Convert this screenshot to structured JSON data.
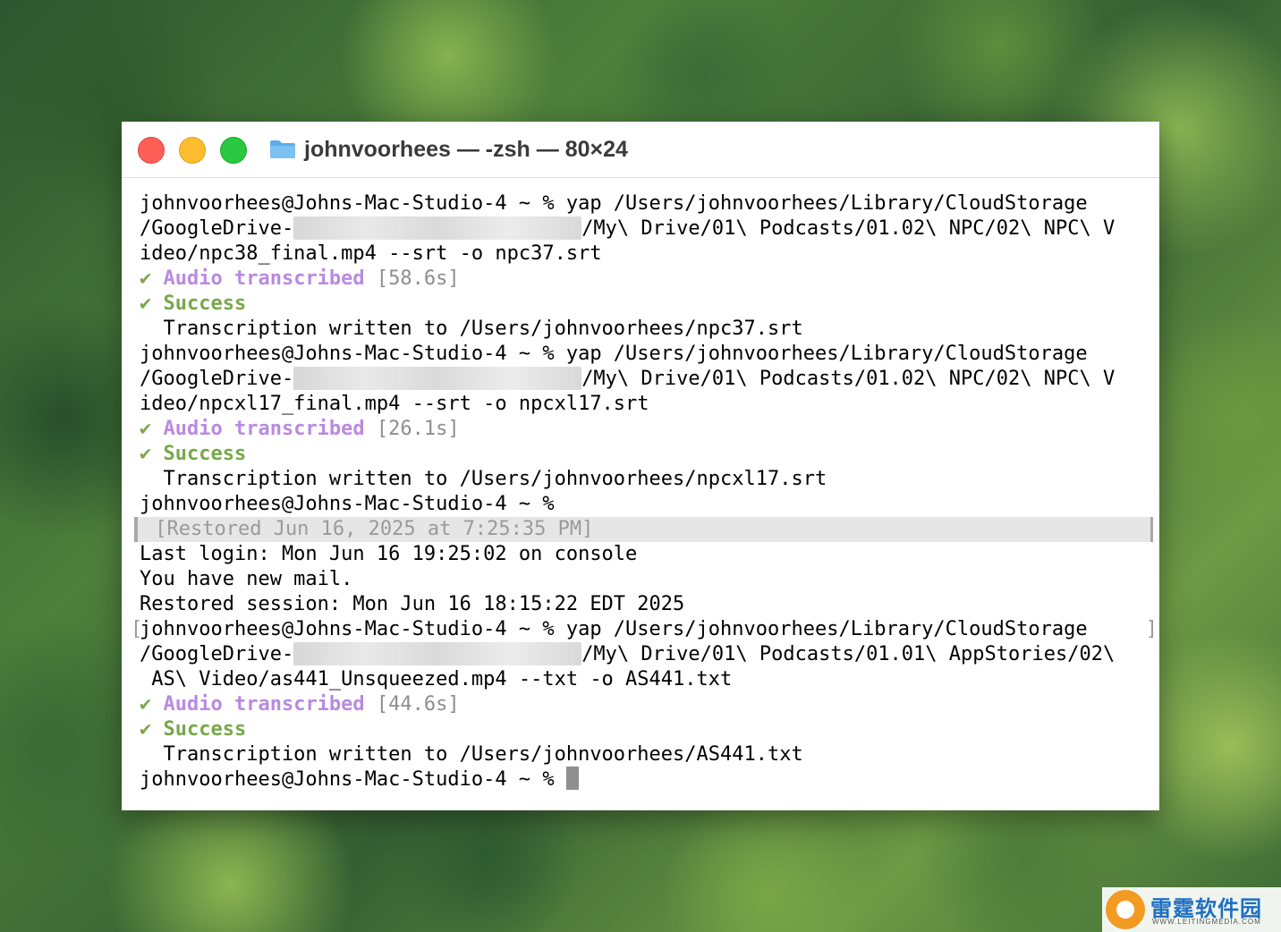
{
  "window": {
    "title": "johnvoorhees — -zsh — 80×24"
  },
  "terminal": {
    "lines": {
      "l1": "johnvoorhees@Johns-Mac-Studio-4 ~ % yap /Users/johnvoorhees/Library/CloudStorage",
      "l2a": "/GoogleDrive-",
      "l2b": "/My\\ Drive/01\\ Podcasts/01.02\\ NPC/02\\ NPC\\ V",
      "l3": "ideo/npc38_final.mp4 --srt -o npc37.srt",
      "l4check": "✔",
      "l4label": "Audio transcribed",
      "l4time": "[58.6s]",
      "l5check": "✔",
      "l5label": "Success",
      "l6": "  Transcription written to /Users/johnvoorhees/npc37.srt",
      "l7": "johnvoorhees@Johns-Mac-Studio-4 ~ % yap /Users/johnvoorhees/Library/CloudStorage",
      "l8a": "/GoogleDrive-",
      "l8b": "/My\\ Drive/01\\ Podcasts/01.02\\ NPC/02\\ NPC\\ V",
      "l9": "ideo/npcxl17_final.mp4 --srt -o npcxl17.srt",
      "l10check": "✔",
      "l10label": "Audio transcribed",
      "l10time": "[26.1s]",
      "l11check": "✔",
      "l11label": "Success",
      "l12": "  Transcription written to /Users/johnvoorhees/npcxl17.srt",
      "l13": "johnvoorhees@Johns-Mac-Studio-4 ~ %",
      "l14": " [Restored Jun 16, 2025 at 7:25:35 PM]",
      "l15": "Last login: Mon Jun 16 19:25:02 on console",
      "l16": "You have new mail.",
      "l17": "Restored session: Mon Jun 16 18:15:22 EDT 2025",
      "l18": "johnvoorhees@Johns-Mac-Studio-4 ~ % yap /Users/johnvoorhees/Library/CloudStorage",
      "l19a": "/GoogleDrive-",
      "l19b": "/My\\ Drive/01\\ Podcasts/01.01\\ AppStories/02\\",
      "l20": " AS\\ Video/as441_Unsqueezed.mp4 --txt -o AS441.txt",
      "l21check": "✔",
      "l21label": "Audio transcribed",
      "l21time": "[44.6s]",
      "l22check": "✔",
      "l22label": "Success",
      "l23": "  Transcription written to /Users/johnvoorhees/AS441.txt",
      "l24": "johnvoorhees@Johns-Mac-Studio-4 ~ % "
    }
  },
  "watermark": {
    "name": "雷霆软件园",
    "url": "WWW.LEITINGMEDIA.COM"
  },
  "colors": {
    "success_green": "#77a84a",
    "audio_purple": "#b98ae0",
    "close": "#ff5f57",
    "minimize": "#febc2e",
    "zoom": "#28c840"
  }
}
